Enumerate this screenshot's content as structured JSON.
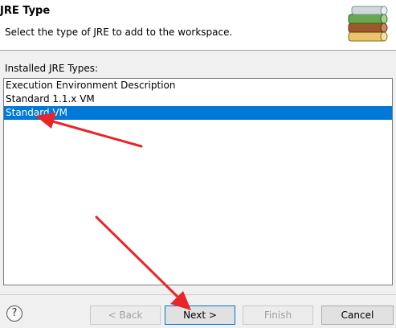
{
  "header": {
    "title": "JRE Type",
    "description": "Select the type of JRE to add to the workspace."
  },
  "list": {
    "label": "Installed JRE Types:",
    "items": [
      {
        "label": "Execution Environment Description",
        "selected": false
      },
      {
        "label": "Standard 1.1.x VM",
        "selected": false
      },
      {
        "label": "Standard VM",
        "selected": true
      }
    ]
  },
  "footer": {
    "help_icon": "question-circle-icon",
    "help_glyph": "?",
    "back_label": "< Back",
    "next_label": "Next >",
    "finish_label": "Finish",
    "cancel_label": "Cancel"
  },
  "colors": {
    "selection": "#0078d7",
    "annotation_arrow": "#e8262a"
  }
}
